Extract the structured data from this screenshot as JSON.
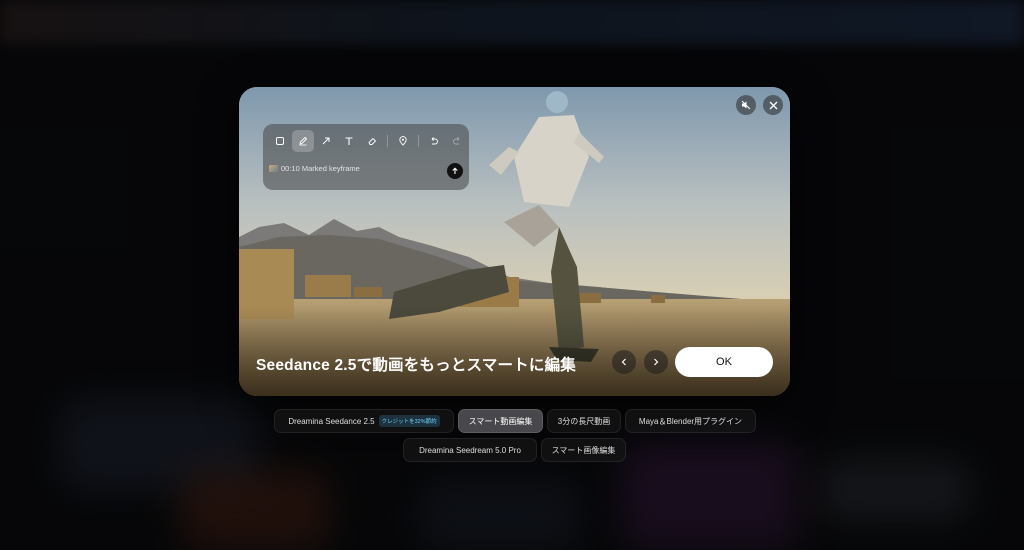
{
  "modal": {
    "mute_icon": "speaker-muted-icon",
    "close_icon": "close-icon",
    "toolbar": {
      "tools": [
        {
          "name": "rectangle-icon",
          "active": false
        },
        {
          "name": "pen-icon",
          "active": true
        },
        {
          "name": "arrow-icon",
          "active": false
        },
        {
          "name": "text-icon",
          "active": false
        },
        {
          "name": "eraser-icon",
          "active": false
        },
        {
          "name": "location-pin-icon",
          "active": false
        },
        {
          "name": "undo-icon",
          "active": false
        },
        {
          "name": "redo-icon",
          "active": false
        }
      ],
      "keyframe_label": "00:10 Marked keyframe",
      "send_icon": "arrow-up-icon"
    },
    "caption": "Seedance 2.5で動画をもっとスマートに編集",
    "ok_label": "OK"
  },
  "features": {
    "row1": [
      {
        "label": "Dreamina Seedance 2.5",
        "badge": "クレジットを32%節約",
        "active": false
      },
      {
        "label": "スマート動画編集",
        "active": true
      },
      {
        "label": "3分の長尺動画",
        "active": false
      },
      {
        "label": "Maya＆Blender用プラグイン",
        "active": false
      }
    ],
    "row2": [
      {
        "label": "Dreamina Seedream 5.0 Pro",
        "active": false
      },
      {
        "label": "スマート画像編集",
        "active": false
      }
    ]
  },
  "colors": {
    "accent_badge": "#6fd3ff",
    "ok_button": "#ffffff"
  }
}
